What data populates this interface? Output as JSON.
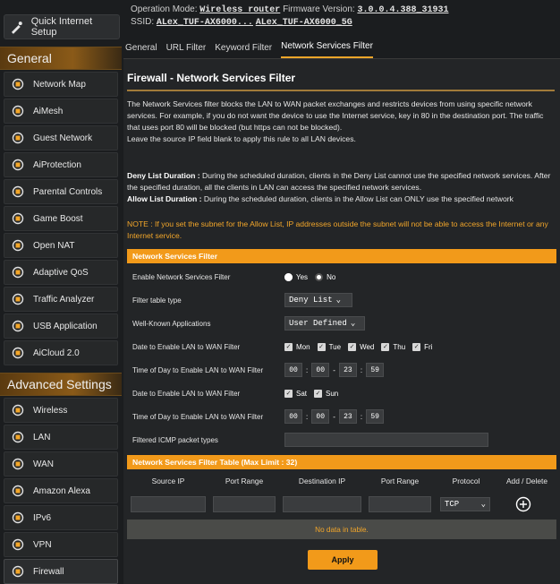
{
  "header": {
    "quick_setup_label": "Quick Internet Setup",
    "operation_mode_label": "Operation Mode:",
    "operation_mode_value": "Wireless router",
    "firmware_label": "Firmware Version:",
    "firmware_value": "3.0.0.4.388_31931",
    "ssid_label": "SSID:",
    "ssid_values": [
      "ALex_TUF-AX6000...",
      "ALex_TUF-AX6000_5G"
    ],
    "icons": [
      "gear-icon",
      "users-icon",
      "network-icon",
      "usb-icon",
      "settings-icon"
    ]
  },
  "sidebar": {
    "general_title": "General",
    "general_items": [
      {
        "label": "Network Map",
        "icon": "network-map-icon"
      },
      {
        "label": "AiMesh",
        "icon": "aimesh-icon"
      },
      {
        "label": "Guest Network",
        "icon": "guest-network-icon"
      },
      {
        "label": "AiProtection",
        "icon": "shield-icon"
      },
      {
        "label": "Parental Controls",
        "icon": "parental-icon"
      },
      {
        "label": "Game Boost",
        "icon": "rocket-icon"
      },
      {
        "label": "Open NAT",
        "icon": "nat-icon"
      },
      {
        "label": "Adaptive QoS",
        "icon": "qos-icon"
      },
      {
        "label": "Traffic Analyzer",
        "icon": "analyzer-icon"
      },
      {
        "label": "USB Application",
        "icon": "usb-app-icon"
      },
      {
        "label": "AiCloud 2.0",
        "icon": "cloud-icon"
      }
    ],
    "advanced_title": "Advanced Settings",
    "advanced_items": [
      {
        "label": "Wireless",
        "icon": "wireless-icon"
      },
      {
        "label": "LAN",
        "icon": "lan-icon"
      },
      {
        "label": "WAN",
        "icon": "globe-icon"
      },
      {
        "label": "Amazon Alexa",
        "icon": "alexa-icon"
      },
      {
        "label": "IPv6",
        "icon": "ipv6-icon"
      },
      {
        "label": "VPN",
        "icon": "vpn-icon"
      },
      {
        "label": "Firewall",
        "icon": "firewall-icon"
      }
    ]
  },
  "tabs": [
    {
      "label": "General",
      "active": false
    },
    {
      "label": "URL Filter",
      "active": false
    },
    {
      "label": "Keyword Filter",
      "active": false
    },
    {
      "label": "Network Services Filter",
      "active": true
    }
  ],
  "page": {
    "title": "Firewall - Network Services Filter",
    "desc1": "The Network Services filter blocks the LAN to WAN packet exchanges and restricts devices from using specific network services. For example, if you do not want the device to use the Internet service, key in 80 in the destination port. The traffic that uses port 80 will be blocked (but https can not be blocked).",
    "desc2": "Leave the source IP field blank to apply this rule to all LAN devices.",
    "deny_label": "Deny List Duration :",
    "deny_text": " During the scheduled duration, clients in the Deny List cannot use the specified network services. After the specified duration, all the clients in LAN can access the specified network services.",
    "allow_label": "Allow List Duration :",
    "allow_text": " During the scheduled duration, clients in the Allow List can ONLY use the specified network",
    "note": "NOTE : If you set the subnet for the Allow List, IP addresses outside the subnet will not be able to access the Internet or any Internet service."
  },
  "filter": {
    "section_title": "Network Services Filter",
    "enable_label": "Enable Network Services Filter",
    "yes": "Yes",
    "no": "No",
    "enabled": false,
    "type_label": "Filter table type",
    "type_value": "Deny List",
    "apps_label": "Well-Known Applications",
    "apps_value": "User Defined",
    "date1_label": "Date to Enable LAN to WAN Filter",
    "weekdays": [
      "Mon",
      "Tue",
      "Wed",
      "Thu",
      "Fri"
    ],
    "time1_label": "Time of Day to Enable LAN to WAN Filter",
    "time1": {
      "h1": "00",
      "m1": "00",
      "h2": "23",
      "m2": "59"
    },
    "date2_label": "Date to Enable LAN to WAN Filter",
    "weekend": [
      "Sat",
      "Sun"
    ],
    "time2_label": "Time of Day to Enable LAN to WAN Filter",
    "time2": {
      "h1": "00",
      "m1": "00",
      "h2": "23",
      "m2": "59"
    },
    "icmp_label": "Filtered ICMP packet types",
    "icmp_value": "",
    "sep_colon": ":",
    "sep_dash": "-"
  },
  "table": {
    "title": "Network Services Filter Table (Max Limit : 32)",
    "columns": [
      "Source IP",
      "Port Range",
      "Destination IP",
      "Port Range",
      "Protocol",
      "Add / Delete"
    ],
    "protocol_value": "TCP",
    "empty_text": "No data in table."
  },
  "apply_label": "Apply"
}
